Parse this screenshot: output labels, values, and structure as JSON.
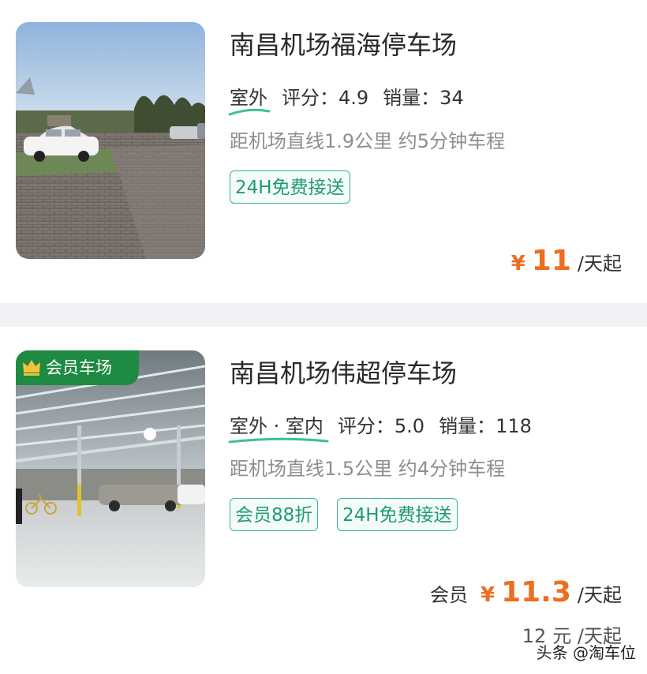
{
  "lots": [
    {
      "name": "南昌机场福海停车场",
      "location": "室外",
      "rating_label": "评分：",
      "rating": "4.9",
      "sales_label": "销量：",
      "sales": "34",
      "distance": "距机场直线1.9公里 约5分钟车程",
      "tags": [
        "24H免费接送"
      ],
      "price_currency": "¥",
      "price": "11",
      "price_unit": "/天起"
    },
    {
      "badge": "会员车场",
      "name": "南昌机场伟超停车场",
      "location": "室外 · 室内",
      "rating_label": "评分：",
      "rating": "5.0",
      "sales_label": "销量：",
      "sales": "118",
      "distance": "距机场直线1.5公里 约4分钟车程",
      "tags": [
        "会员88折",
        "24H免费接送"
      ],
      "member_label": "会员",
      "price_currency": "¥",
      "price": "11.3",
      "price_unit": "/天起",
      "original_price": "12",
      "original_price_unit": "元 /天起"
    }
  ],
  "watermark": "头条 @淘车位",
  "colors": {
    "accent_orange": "#ee6d1f",
    "tag_green": "#1f9c6d",
    "badge_green": "#1e8a42"
  }
}
